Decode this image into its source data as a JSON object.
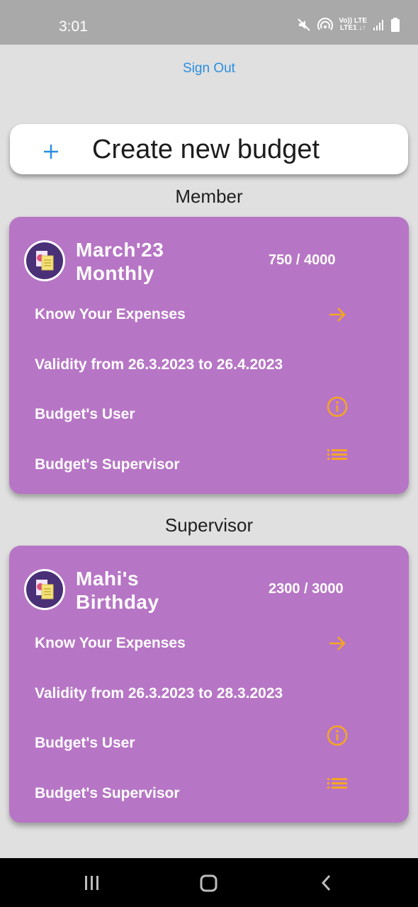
{
  "status": {
    "time": "3:01",
    "lte_top": "Vo)) LTE",
    "lte_bottom": "LTE1 ↓↑"
  },
  "header": {
    "sign_out_label": "Sign Out"
  },
  "create": {
    "label": "Create new budget",
    "icon": "plus-icon"
  },
  "sections": [
    {
      "heading": "Member",
      "card": {
        "title_line1": "March'23",
        "title_line2": "Monthly",
        "amount": "750 / 4000",
        "expenses_label": "Know Your Expenses",
        "validity": "Validity from 26.3.2023 to 26.4.2023",
        "user_label": "Budget's User",
        "supervisor_label": "Budget's Supervisor"
      }
    },
    {
      "heading": "Supervisor",
      "card": {
        "title_line1": "Mahi's",
        "title_line2": "Birthday",
        "amount": "2300 / 3000",
        "expenses_label": "Know Your Expenses",
        "validity": "Validity from 26.3.2023 to 28.3.2023",
        "user_label": "Budget's User",
        "supervisor_label": "Budget's Supervisor"
      }
    }
  ],
  "colors": {
    "accent": "#2a8fe0",
    "card": "#b775c5",
    "icon_accent": "#f5a623"
  },
  "icons": [
    "arrow-right-icon",
    "info-icon",
    "list-icon",
    "plus-icon"
  ]
}
